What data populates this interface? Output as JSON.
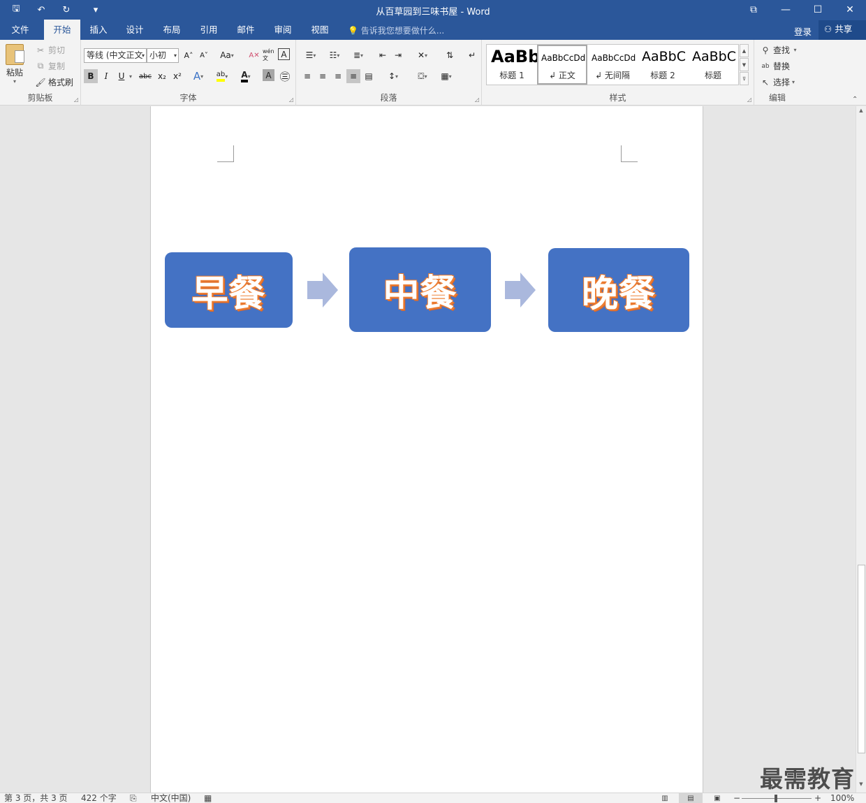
{
  "window": {
    "title": "从百草园到三味书屋 - Word",
    "qat": {
      "save_icon": "🖫",
      "undo_icon": "↶",
      "redo_icon": "↻",
      "customize_icon": "▾"
    },
    "controls": {
      "ribbon_display": "⧉",
      "minimize": "—",
      "maximize": "☐",
      "close": "✕"
    }
  },
  "tabs": [
    {
      "label": "文件"
    },
    {
      "label": "开始"
    },
    {
      "label": "插入"
    },
    {
      "label": "设计"
    },
    {
      "label": "布局"
    },
    {
      "label": "引用"
    },
    {
      "label": "邮件"
    },
    {
      "label": "审阅"
    },
    {
      "label": "视图"
    }
  ],
  "tellme": {
    "placeholder": "告诉我您想要做什么..."
  },
  "account": {
    "login": "登录",
    "share": "共享"
  },
  "ribbon": {
    "clipboard": {
      "label": "剪贴板",
      "paste": "粘贴",
      "cut": "剪切",
      "copy": "复制",
      "format_painter": "格式刷"
    },
    "font": {
      "label": "字体",
      "font_name": "等线 (中文正文",
      "font_size": "小初",
      "grow": "A˄",
      "shrink": "A˅",
      "change_case": "Aa",
      "clear": "A✕",
      "phonetic": "wén文",
      "border_char": "A",
      "bold": "B",
      "italic": "I",
      "underline": "U",
      "strike": "abc",
      "subscript": "x₂",
      "superscript": "x²",
      "text_effect": "A",
      "highlight": "ab",
      "font_color": "A",
      "char_shading": "A",
      "enclose": "㊂"
    },
    "paragraph": {
      "label": "段落"
    },
    "styles": {
      "label": "样式",
      "items": [
        {
          "preview": "AaBb",
          "name": "标题 1"
        },
        {
          "preview": "AaBbCcDd",
          "name": "↲ 正文"
        },
        {
          "preview": "AaBbCcDd",
          "name": "↲ 无间隔"
        },
        {
          "preview": "AaBbC",
          "name": "标题 2"
        },
        {
          "preview": "AaBbC",
          "name": "标题"
        }
      ]
    },
    "editing": {
      "label": "编辑",
      "find": "查找",
      "replace": "替换",
      "select": "选择"
    }
  },
  "document": {
    "smartart": [
      {
        "text": "早餐"
      },
      {
        "text": "中餐"
      },
      {
        "text": "晚餐"
      }
    ],
    "colors": {
      "box_fill": "#4472c4",
      "text_outline": "#ed7d31",
      "arrow": "#aab8dd"
    }
  },
  "watermark": "最需教育",
  "status": {
    "page": "第 3 页，共 3 页",
    "words": "422 个字",
    "language": "中文(中国)",
    "zoom": "100%"
  }
}
